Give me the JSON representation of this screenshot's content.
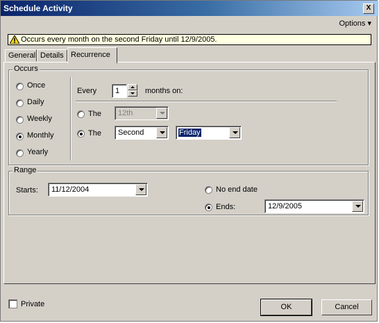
{
  "window": {
    "title": "Schedule Activity",
    "close_glyph": "X"
  },
  "toolbar": {
    "options_label": "Options",
    "options_arrow": "▾"
  },
  "info": {
    "text": "Occurs every month on the second Friday until 12/9/2005."
  },
  "tabs": [
    {
      "label": "General"
    },
    {
      "label": "Details"
    },
    {
      "label": "Recurrence"
    }
  ],
  "occurs": {
    "legend": "Occurs",
    "options": [
      {
        "label": "Once",
        "selected": false
      },
      {
        "label": "Daily",
        "selected": false
      },
      {
        "label": "Weekly",
        "selected": false
      },
      {
        "label": "Monthly",
        "selected": true
      },
      {
        "label": "Yearly",
        "selected": false
      }
    ],
    "every_label": "Every",
    "every_value": "1",
    "months_on_label": "months on:",
    "the_label_1": "The",
    "day_number_value": "12th",
    "the_label_2": "The",
    "ordinal_value": "Second",
    "weekday_value": "Friday"
  },
  "range": {
    "legend": "Range",
    "starts_label": "Starts:",
    "starts_value": "11/12/2004",
    "no_end_label": "No end date",
    "ends_label": "Ends:",
    "ends_value": "12/9/2005"
  },
  "footer": {
    "private_label": "Private",
    "ok_label": "OK",
    "cancel_label": "Cancel"
  },
  "colors": {
    "titlebar_start": "#0a246a",
    "titlebar_end": "#a6caf0",
    "dialog_bg": "#d4d0c8",
    "info_bg": "#ffffe1",
    "highlight": "#0a246a"
  }
}
